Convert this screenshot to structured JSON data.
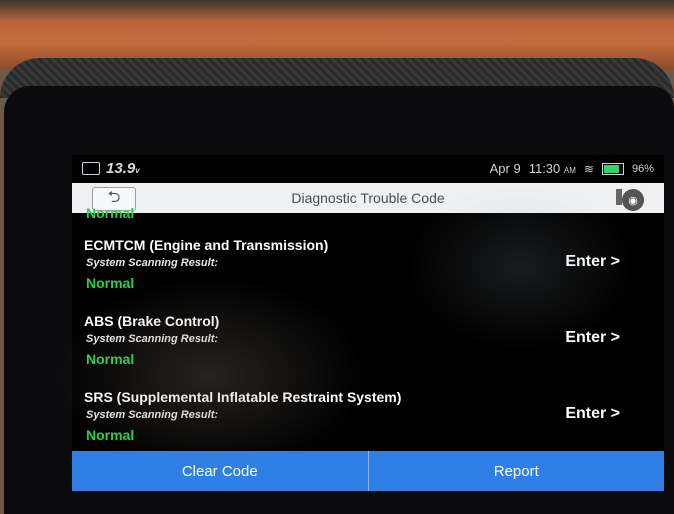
{
  "status_bar": {
    "voltage": "13.9",
    "voltage_unit": "v",
    "date": "Apr 9",
    "time": "11:30",
    "ampm": "AM",
    "battery": "96%"
  },
  "header": {
    "title": "Diagnostic Trouble Code"
  },
  "list": {
    "partial_status": "Normal",
    "items": [
      {
        "name": "ECMTCM (Engine and Transmission)",
        "label": "System Scanning Result:",
        "status": "Normal",
        "action": "Enter >"
      },
      {
        "name": "ABS (Brake Control)",
        "label": "System Scanning Result:",
        "status": "Normal",
        "action": "Enter >"
      },
      {
        "name": "SRS (Supplemental Inflatable Restraint System)",
        "label": "System Scanning Result:",
        "status": "Normal",
        "action": "Enter >"
      }
    ]
  },
  "bottom_bar": {
    "clear_code": "Clear Code",
    "report": "Report"
  },
  "icons": {
    "back": "back-arrow-icon",
    "camera": "camera-icon",
    "wifi": "wifi-icon",
    "battery": "battery-icon"
  },
  "colors": {
    "normal_status": "#25d34a",
    "action_button": "#2f7fe6"
  }
}
